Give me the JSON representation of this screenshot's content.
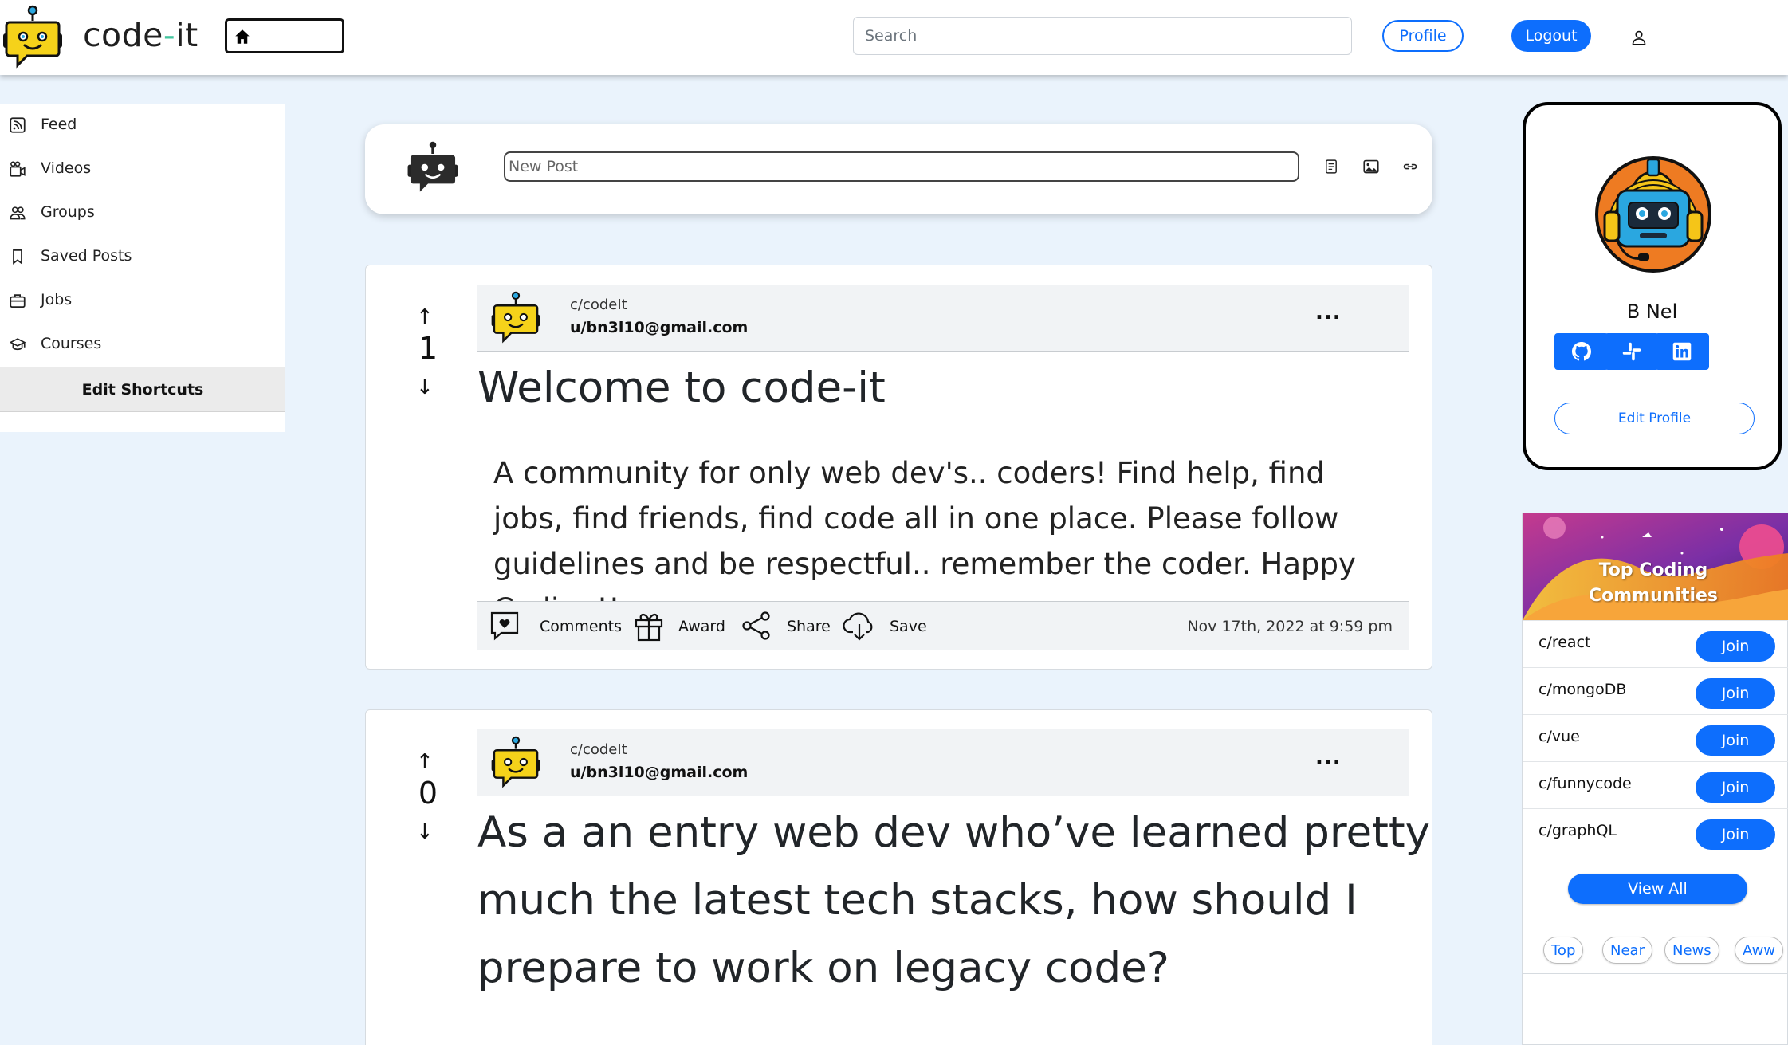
{
  "brand": {
    "name_prefix": "code",
    "name_dash": "-",
    "name_suffix": "it"
  },
  "search": {
    "placeholder": "Search"
  },
  "nav": {
    "profile_label": "Profile",
    "logout_label": "Logout"
  },
  "sidebar": {
    "items": [
      {
        "label": "Feed",
        "icon": "rss-icon"
      },
      {
        "label": "Videos",
        "icon": "film-icon"
      },
      {
        "label": "Groups",
        "icon": "people-icon"
      },
      {
        "label": "Saved Posts",
        "icon": "bookmark-icon"
      },
      {
        "label": "Jobs",
        "icon": "briefcase-icon"
      },
      {
        "label": "Courses",
        "icon": "mortarboard-icon"
      }
    ],
    "edit_shortcuts": "Edit Shortcuts"
  },
  "new_post": {
    "placeholder": "New Post"
  },
  "posts": [
    {
      "votes": "1",
      "community": "c/codeIt",
      "user": "u/bn3l10@gmail.com",
      "more": "...",
      "title": "Welcome to code-it",
      "body": "A community for only web dev's.. coders! Find help, find jobs, find friends, find code all in one place. Please follow guidelines and be respectful.. remember the coder. Happy Coding!!",
      "actions": {
        "comments": "Comments",
        "award": "Award",
        "share": "Share",
        "save": "Save"
      },
      "date": "Nov 17th, 2022 at 9:59 pm"
    },
    {
      "votes": "0",
      "community": "c/codeIt",
      "user": "u/bn3l10@gmail.com",
      "more": "...",
      "title_lines": [
        "As a an entry web dev who’ve learned pretty",
        "much the latest tech stacks, how should I",
        "prepare to work on legacy code?"
      ]
    }
  ],
  "profile": {
    "name": "B Nel",
    "socials": [
      "github-icon",
      "slack-icon",
      "linkedin-icon"
    ],
    "edit_label": "Edit Profile"
  },
  "communities": {
    "banner_title_line1": "Top Coding",
    "banner_title_line2": "Communities",
    "items": [
      {
        "name": "c/react",
        "join": "Join"
      },
      {
        "name": "c/mongoDB",
        "join": "Join"
      },
      {
        "name": "c/vue",
        "join": "Join"
      },
      {
        "name": "c/funnycode",
        "join": "Join"
      },
      {
        "name": "c/graphQL",
        "join": "Join"
      }
    ],
    "view_all": "View All",
    "tags": [
      "Top",
      "Near",
      "News",
      "Aww"
    ]
  },
  "colors": {
    "accent": "#0d6efd",
    "background": "#eaf3fc",
    "brand_dash": "#43c59e",
    "robot_yellow": "#f5d21a"
  }
}
